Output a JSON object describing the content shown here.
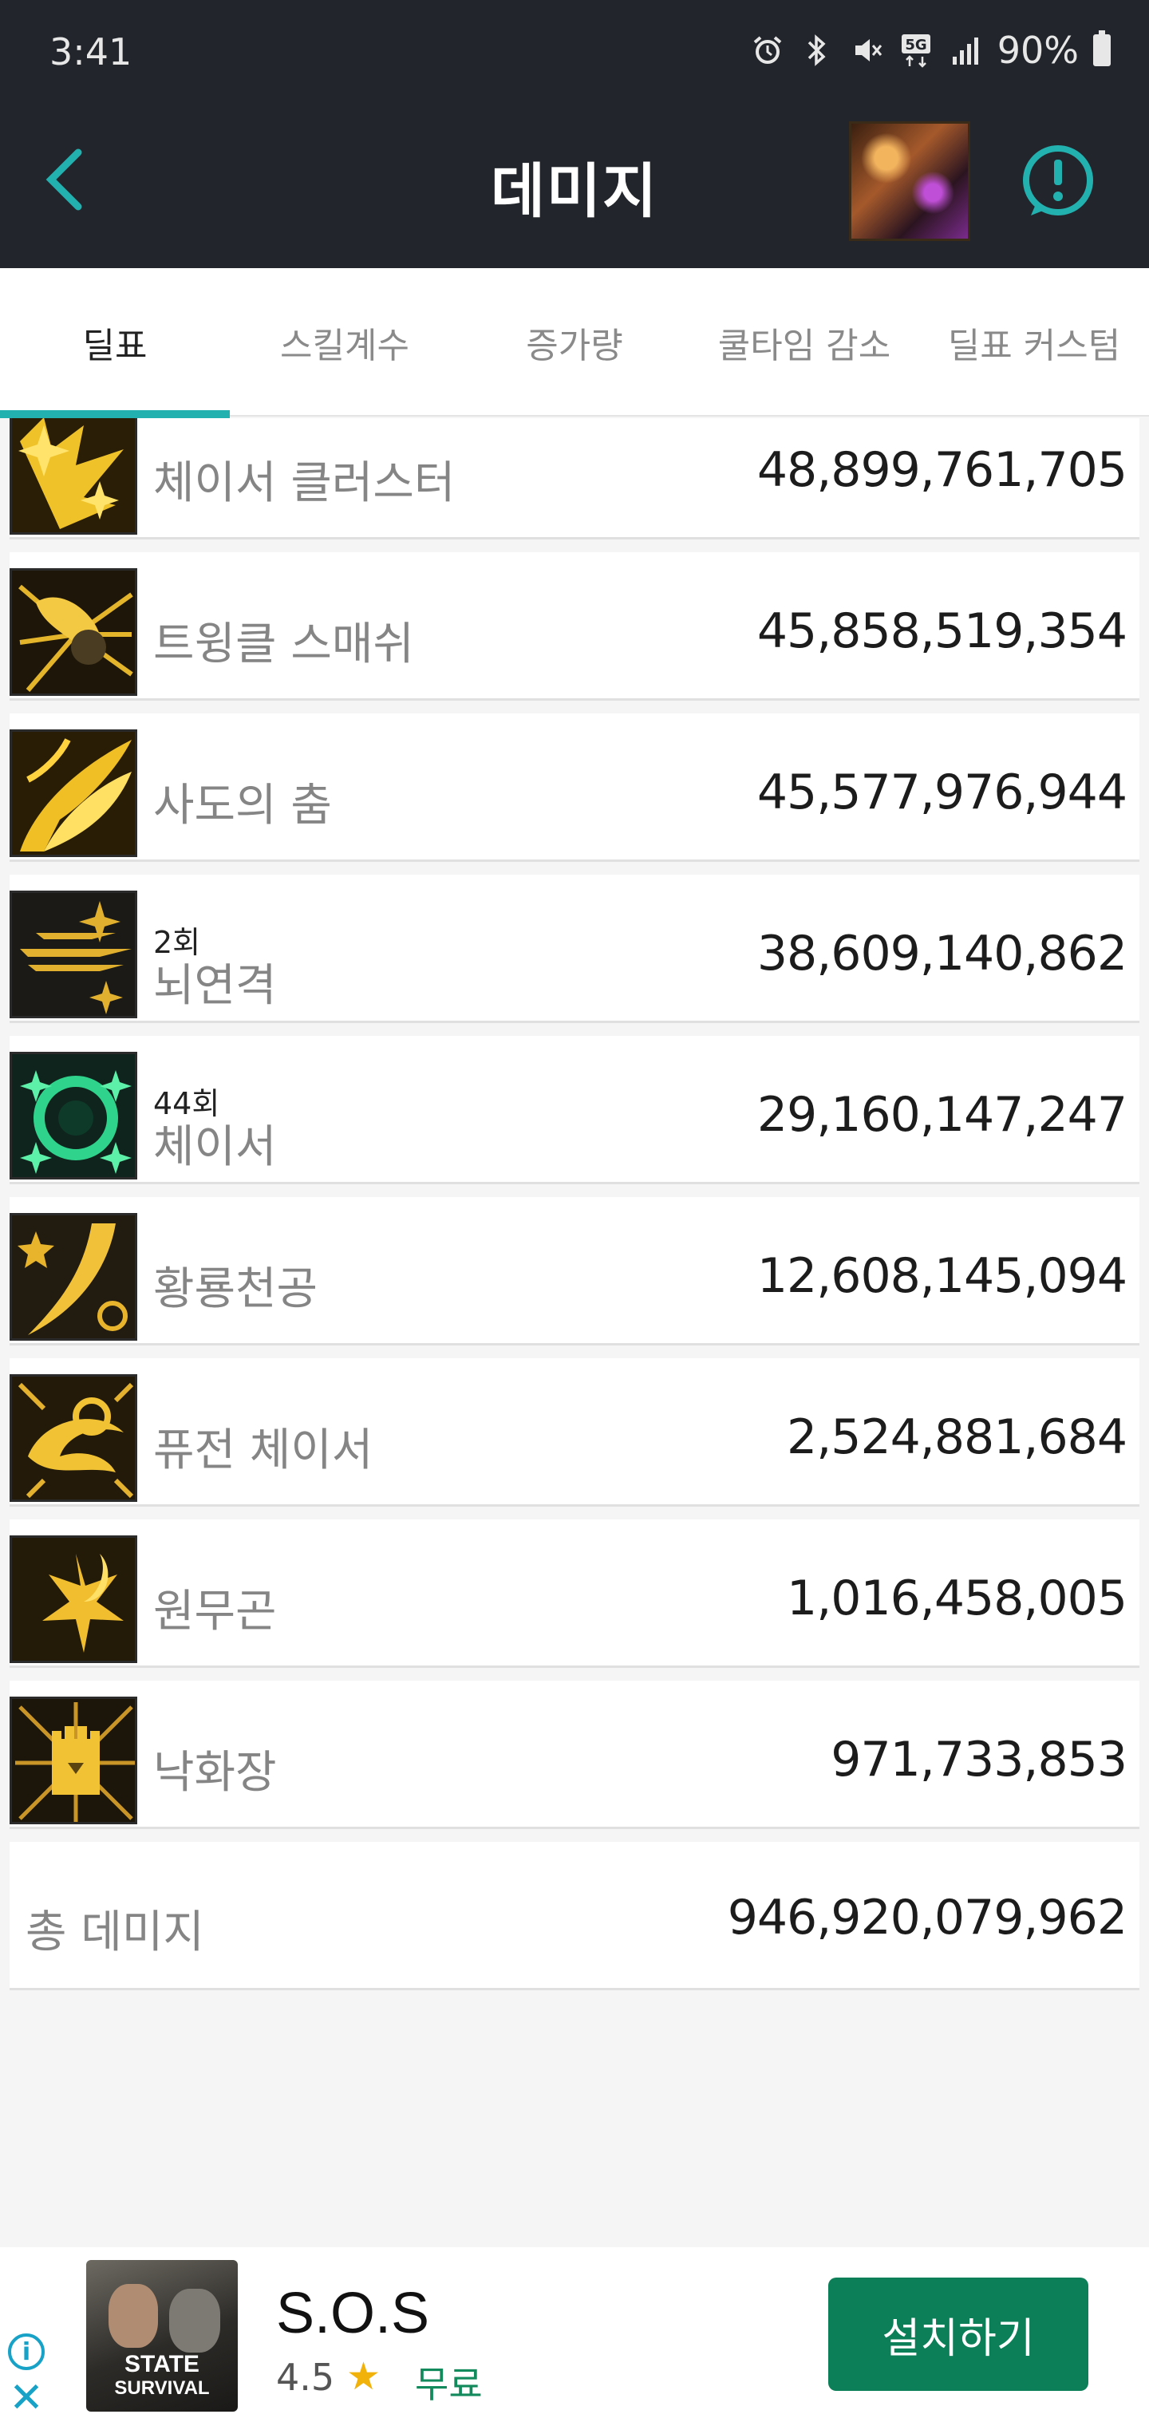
{
  "status": {
    "time": "3:41",
    "battery": "90%",
    "icons": [
      "alarm-icon",
      "bluetooth-icon",
      "mute-icon",
      "5g-icon",
      "signal-icon",
      "battery-icon"
    ]
  },
  "header": {
    "title": "데미지",
    "back_icon": "chevron-left-icon",
    "info_icon": "info-circle-icon"
  },
  "tabs": [
    {
      "label": "딜표",
      "active": true
    },
    {
      "label": "스킬계수",
      "active": false
    },
    {
      "label": "증가량",
      "active": false
    },
    {
      "label": "쿨타임 감소",
      "active": false
    },
    {
      "label": "딜표 커스텀",
      "active": false
    }
  ],
  "skills": [
    {
      "name": "체이서 클러스터",
      "count": "",
      "value": "48,899,761,705"
    },
    {
      "name": "트윙클 스매쉬",
      "count": "",
      "value": "45,858,519,354"
    },
    {
      "name": "사도의 춤",
      "count": "",
      "value": "45,577,976,944"
    },
    {
      "name": "뇌연격",
      "count": "2회",
      "value": "38,609,140,862"
    },
    {
      "name": "체이서",
      "count": "44회",
      "value": "29,160,147,247"
    },
    {
      "name": "황룡천공",
      "count": "",
      "value": "12,608,145,094"
    },
    {
      "name": "퓨전 체이서",
      "count": "",
      "value": "2,524,881,684"
    },
    {
      "name": "원무곤",
      "count": "",
      "value": "1,016,458,005"
    },
    {
      "name": "낙화장",
      "count": "",
      "value": "971,733,853"
    }
  ],
  "total": {
    "label": "총 데미지",
    "value": "946,920,079,962"
  },
  "ad": {
    "app_name": "S.O.S",
    "icon_text_line1": "STATE",
    "icon_text_line2": "SURVIVAL",
    "rating": "4.5",
    "price": "무료",
    "install_label": "설치하기",
    "star_color": "#f1b20c",
    "button_color": "#0d7f58"
  },
  "colors": {
    "accent": "#23b1b0",
    "header_bg": "#22252b"
  }
}
